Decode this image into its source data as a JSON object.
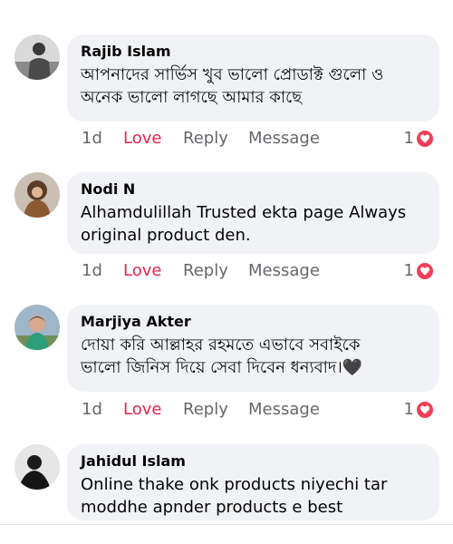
{
  "comments": [
    {
      "name": "Rajib Islam",
      "text": "আপনাদের সার্ভিস খুব ভালো প্রোডাক্ট গুলো ও\nঅনেক ভালো লাগছে আমার কাছে",
      "time": "1d",
      "love": "Love",
      "reply": "Reply",
      "message": "Message",
      "reactions": "1"
    },
    {
      "name": "Nodi N",
      "text": "Alhamdulillah Trusted ekta page Always\noriginal product den.",
      "time": "1d",
      "love": "Love",
      "reply": "Reply",
      "message": "Message",
      "reactions": "1"
    },
    {
      "name": "Marjiya Akter",
      "text": "দোয়া করি আল্লাহর রহমতে এভাবে সবাইকে\nভালো জিনিস দিয়ে সেবা দিবেন ধন্যবাদ।🖤",
      "time": "1d",
      "love": "Love",
      "reply": "Reply",
      "message": "Message",
      "reactions": "1"
    },
    {
      "name": "Jahidul Islam",
      "text": "Online thake onk products niyechi tar\nmoddhe apnder products e best"
    }
  ],
  "colors": {
    "love": "#e6254e",
    "heart": "#f33e58",
    "bubble": "#f0f2f5",
    "secondary_text": "#65676b"
  }
}
